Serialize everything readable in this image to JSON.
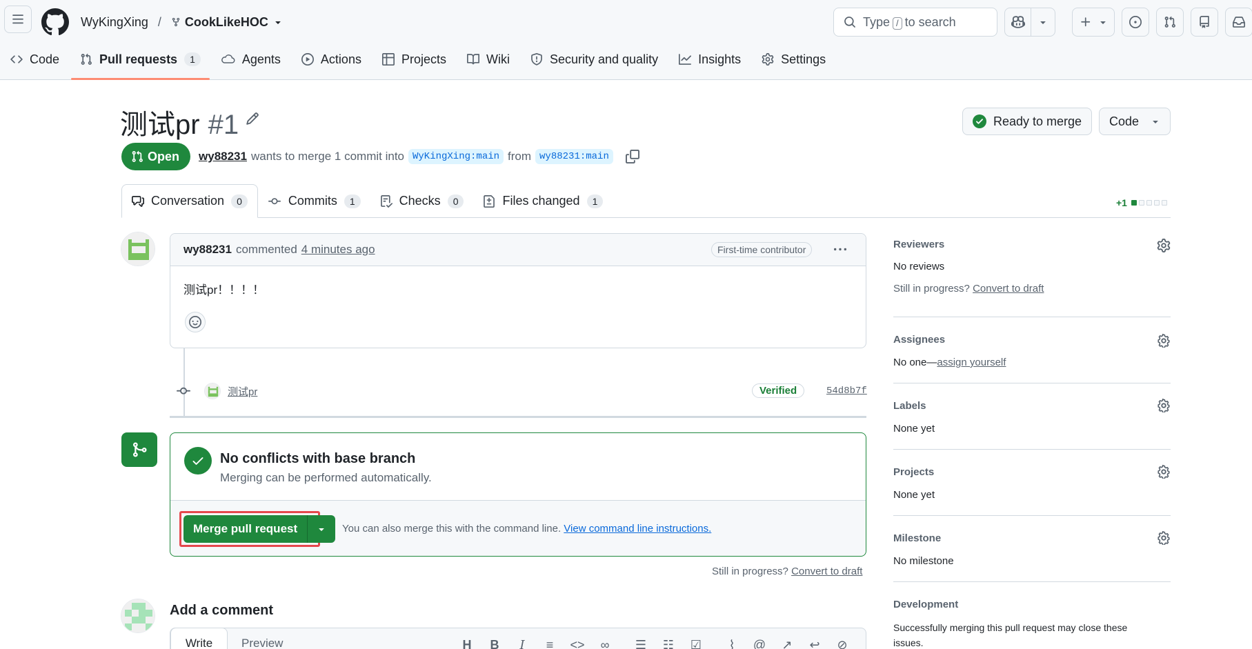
{
  "header": {
    "owner": "WyKingXing",
    "separator": "/",
    "repo": "CookLikeHOC",
    "search_prefix": "Type",
    "search_key": "/",
    "search_suffix": "to search"
  },
  "repo_nav": {
    "items": [
      {
        "label": "Code",
        "icon": "code-icon"
      },
      {
        "label": "Pull requests",
        "icon": "git-pull-request-icon",
        "count": "1"
      },
      {
        "label": "Agents",
        "icon": "agents-icon"
      },
      {
        "label": "Actions",
        "icon": "play-icon"
      },
      {
        "label": "Projects",
        "icon": "table-icon"
      },
      {
        "label": "Wiki",
        "icon": "book-icon"
      },
      {
        "label": "Security and quality",
        "icon": "shield-icon"
      },
      {
        "label": "Insights",
        "icon": "graph-icon"
      },
      {
        "label": "Settings",
        "icon": "gear-icon"
      }
    ]
  },
  "pr": {
    "title": "测试pr",
    "number": "#1",
    "ready_label": "Ready to merge",
    "code_label": "Code",
    "state": "Open",
    "author": "wy88231",
    "meta_text": "wants to merge 1 commit into",
    "base_branch": "WyKingXing:main",
    "from_text": "from",
    "head_branch": "wy88231:main"
  },
  "tabs": [
    {
      "label": "Conversation",
      "count": "0",
      "icon": "comment-discussion-icon"
    },
    {
      "label": "Commits",
      "count": "1",
      "icon": "commit-icon"
    },
    {
      "label": "Checks",
      "count": "0",
      "icon": "checklist-icon"
    },
    {
      "label": "Files changed",
      "count": "1",
      "icon": "file-diff-icon"
    }
  ],
  "diffstat": {
    "additions": "+1",
    "blocks_filled": 1,
    "blocks_total": 5
  },
  "comment": {
    "author": "wy88231",
    "action": "commented",
    "time": "4 minutes ago",
    "badge": "First-time contributor",
    "body": "测试pr！！！！"
  },
  "commit": {
    "message": "测试pr",
    "verified": "Verified",
    "sha": "54d8b7f"
  },
  "merge": {
    "title": "No conflicts with base branch",
    "subtitle": "Merging can be performed automatically.",
    "button": "Merge pull request",
    "cli_text": "You can also merge this with the command line.",
    "cli_link": "View command line instructions.",
    "still_text": "Still in progress?",
    "convert_link": "Convert to draft"
  },
  "add_comment": {
    "title": "Add a comment",
    "write_tab": "Write",
    "preview_tab": "Preview"
  },
  "sidebar": {
    "reviewers": {
      "title": "Reviewers",
      "value": "No reviews",
      "still": "Still in progress?",
      "link": "Convert to draft"
    },
    "assignees": {
      "title": "Assignees",
      "value": "No one—",
      "link": "assign yourself"
    },
    "labels": {
      "title": "Labels",
      "value": "None yet"
    },
    "projects": {
      "title": "Projects",
      "value": "None yet"
    },
    "milestone": {
      "title": "Milestone",
      "value": "No milestone"
    },
    "development": {
      "title": "Development",
      "value": "Successfully merging this pull request may close these issues."
    }
  },
  "colors": {
    "green": "#1f883d",
    "accent_underline": "#fd8c73",
    "link_blue": "#0969da",
    "highlight_red": "#e5484d"
  }
}
